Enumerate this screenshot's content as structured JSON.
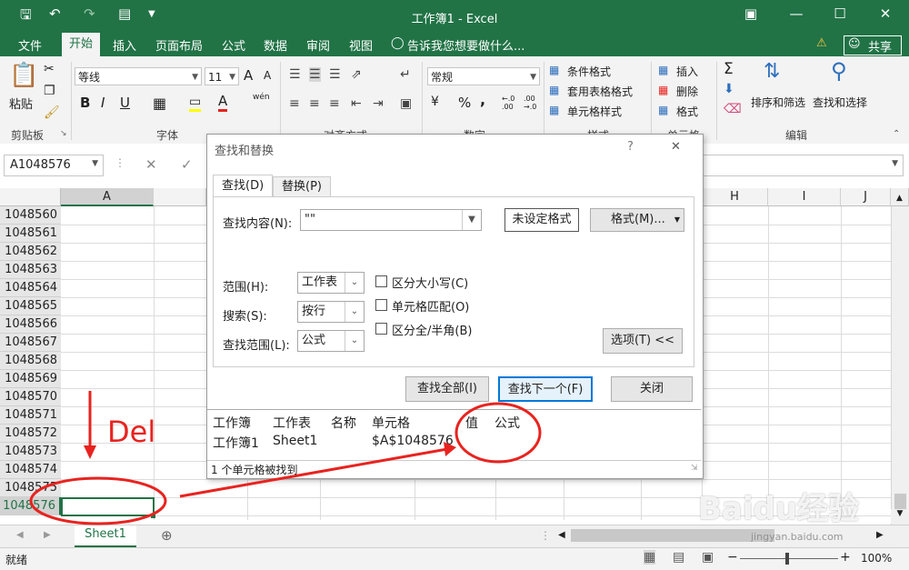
{
  "titlebar": {
    "title": "工作簿1 - Excel",
    "save_icon": "save-icon",
    "undo_icon": "undo-icon",
    "redo_icon": "redo-icon",
    "minimize": "—",
    "restore": "☐",
    "close": "✕",
    "ribbon_display": "▣"
  },
  "tabs": [
    "文件",
    "开始",
    "插入",
    "页面布局",
    "公式",
    "数据",
    "审阅",
    "视图"
  ],
  "active_tab": "开始",
  "tell_me": "告诉我您想要做什么...",
  "share_label": "共享",
  "ribbon": {
    "clipboard": {
      "paste": "粘贴",
      "label": "剪贴板"
    },
    "font": {
      "name": "等线",
      "size": "11",
      "label": "字体",
      "bold": "B",
      "italic": "I",
      "underline": "U",
      "grow": "A",
      "shrink": "A",
      "font_color": "A",
      "phonetic": "wén"
    },
    "alignment": {
      "label": "对齐方式"
    },
    "number": {
      "format": "常规",
      "label": "数字",
      "percent": "%",
      "comma": ",",
      "inc": "←.0 .00",
      "dec": ".00 →.0"
    },
    "styles": {
      "conditional": "条件格式",
      "table": "套用表格格式",
      "cell": "单元格样式",
      "label": "样式"
    },
    "cells": {
      "insert": "插入",
      "delete": "删除",
      "format": "格式",
      "label": "单元格"
    },
    "editing": {
      "sum": "Σ",
      "sort": "排序和筛选",
      "find": "查找和选择",
      "label": "编辑"
    }
  },
  "formula_bar": {
    "name_box": "A1048576",
    "cancel": "✕",
    "enter": "✓"
  },
  "columns": [
    "A",
    "H",
    "I",
    "J"
  ],
  "rows": [
    "1048560",
    "1048561",
    "1048562",
    "1048563",
    "1048564",
    "1048565",
    "1048566",
    "1048567",
    "1048568",
    "1048569",
    "1048570",
    "1048571",
    "1048572",
    "1048573",
    "1048574",
    "1048575",
    "1048576"
  ],
  "dialog": {
    "title": "查找和替换",
    "help": "?",
    "close": "✕",
    "tabs": [
      "查找(D)",
      "替换(P)"
    ],
    "find_label": "查找内容(N):",
    "find_value": "\"\"",
    "no_format": "未设定格式",
    "format_btn": "格式(M)...",
    "scope_label": "范围(H):",
    "scope_value": "工作表",
    "search_label": "搜索(S):",
    "search_value": "按行",
    "lookin_label": "查找范围(L):",
    "lookin_value": "公式",
    "opt_case": "区分大小写(C)",
    "opt_entire": "单元格匹配(O)",
    "opt_width": "区分全/半角(B)",
    "options_btn": "选项(T) <<",
    "find_all": "查找全部(I)",
    "find_next": "查找下一个(F)",
    "close_btn": "关闭",
    "results_headers": [
      "工作簿",
      "工作表",
      "名称",
      "单元格",
      "值",
      "公式"
    ],
    "results": [
      {
        "book": "工作簿1",
        "sheet": "Sheet1",
        "name": "",
        "cell": "$A$1048576",
        "value": "",
        "formula": ""
      }
    ],
    "status": "1 个单元格被找到"
  },
  "annotation": {
    "text": "Del",
    "color": "#e8231f"
  },
  "sheet_tab": "Sheet1",
  "status": {
    "ready": "就绪",
    "zoom": "100%",
    "minus": "−",
    "plus": "+"
  },
  "watermark": {
    "text1": "Baidu经验",
    "text2": "jingyan.baidu.com"
  },
  "colors": {
    "excel_green": "#217346",
    "annotation_red": "#e8231f"
  }
}
